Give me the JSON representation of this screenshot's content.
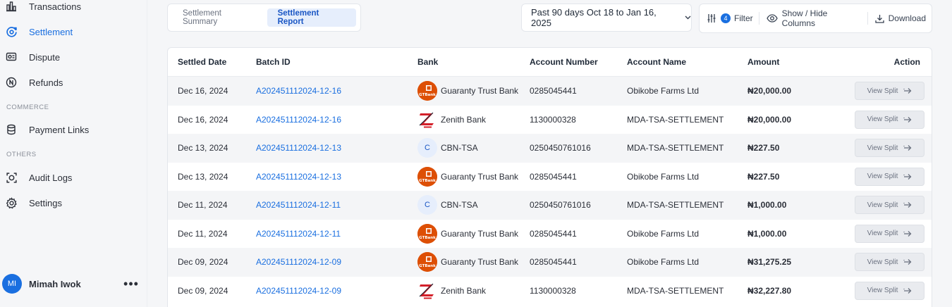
{
  "sidebar": {
    "items": [
      {
        "label": "Transactions",
        "icon": "bar-chart-icon"
      },
      {
        "label": "Settlement",
        "icon": "settlement-icon",
        "active": true
      },
      {
        "label": "Dispute",
        "icon": "dispute-icon"
      },
      {
        "label": "Refunds",
        "icon": "refund-icon"
      },
      {
        "label": "Payment Links",
        "icon": "database-icon"
      },
      {
        "label": "Audit Logs",
        "icon": "audit-icon"
      },
      {
        "label": "Settings",
        "icon": "gear-icon"
      }
    ],
    "sections": {
      "commerce": "COMMERCE",
      "others": "OTHERS"
    },
    "user": {
      "initials": "MI",
      "name": "Mimah Iwok"
    }
  },
  "tabs": [
    {
      "label": "Settlement Summary",
      "active": false
    },
    {
      "label": "Settlement Report",
      "active": true
    }
  ],
  "date_range": {
    "label": "Past 90 days Oct 18 to Jan 16, 2025"
  },
  "toolbar": {
    "filter_count": "4",
    "filter_label": "Filter",
    "columns_label": "Show / Hide Columns",
    "download_label": "Download"
  },
  "table": {
    "headers": {
      "date": "Settled Date",
      "batch": "Batch ID",
      "bank": "Bank",
      "account_number": "Account Number",
      "account_name": "Account Name",
      "amount": "Amount",
      "action": "Action"
    },
    "rows": [
      {
        "date": "Dec 16, 2024",
        "batch": "A202451112024-12-16",
        "bank": "Guaranty Trust Bank",
        "logo": "gtbank",
        "account_number": "0285045441",
        "account_name": "Obikobe Farms Ltd",
        "amount": "₦20,000.00",
        "action": "View Split"
      },
      {
        "date": "Dec 16, 2024",
        "batch": "A202451112024-12-16",
        "bank": "Zenith Bank",
        "logo": "zenith",
        "account_number": "1130000328",
        "account_name": "MDA-TSA-SETTLEMENT",
        "amount": "₦20,000.00",
        "action": "View Split"
      },
      {
        "date": "Dec 13, 2024",
        "batch": "A202451112024-12-13",
        "bank": "CBN-TSA",
        "logo": "cbn",
        "logo_text": "C",
        "account_number": "0250450761016",
        "account_name": "MDA-TSA-SETTLEMENT",
        "amount": "₦227.50",
        "action": "View Split"
      },
      {
        "date": "Dec 13, 2024",
        "batch": "A202451112024-12-13",
        "bank": "Guaranty Trust Bank",
        "logo": "gtbank",
        "account_number": "0285045441",
        "account_name": "Obikobe Farms Ltd",
        "amount": "₦227.50",
        "action": "View Split"
      },
      {
        "date": "Dec 11, 2024",
        "batch": "A202451112024-12-11",
        "bank": "CBN-TSA",
        "logo": "cbn",
        "logo_text": "C",
        "account_number": "0250450761016",
        "account_name": "MDA-TSA-SETTLEMENT",
        "amount": "₦1,000.00",
        "action": "View Split"
      },
      {
        "date": "Dec 11, 2024",
        "batch": "A202451112024-12-11",
        "bank": "Guaranty Trust Bank",
        "logo": "gtbank",
        "account_number": "0285045441",
        "account_name": "Obikobe Farms Ltd",
        "amount": "₦1,000.00",
        "action": "View Split"
      },
      {
        "date": "Dec 09, 2024",
        "batch": "A202451112024-12-09",
        "bank": "Guaranty Trust Bank",
        "logo": "gtbank",
        "account_number": "0285045441",
        "account_name": "Obikobe Farms Ltd",
        "amount": "₦31,275.25",
        "action": "View Split"
      },
      {
        "date": "Dec 09, 2024",
        "batch": "A202451112024-12-09",
        "bank": "Zenith Bank",
        "logo": "zenith",
        "account_number": "1130000328",
        "account_name": "MDA-TSA-SETTLEMENT",
        "amount": "₦32,227.80",
        "action": "View Split"
      }
    ]
  },
  "colors": {
    "accent": "#1a6fe0",
    "gtbank": "#dd4f05",
    "zenith": "#d4202a"
  }
}
